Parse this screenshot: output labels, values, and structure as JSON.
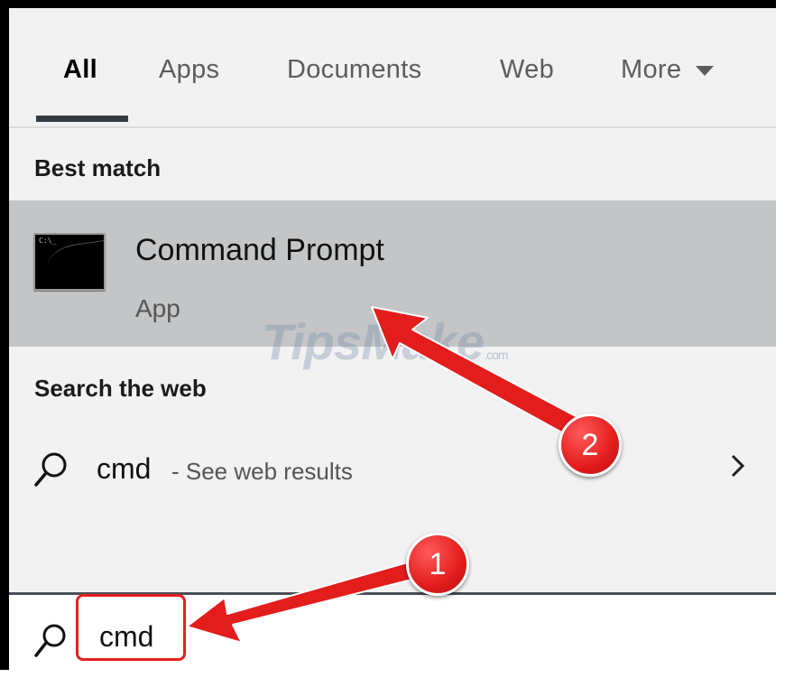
{
  "tabs": [
    {
      "label": "All",
      "active": true
    },
    {
      "label": "Apps"
    },
    {
      "label": "Documents"
    },
    {
      "label": "Web"
    },
    {
      "label": "More"
    }
  ],
  "best_match": {
    "heading": "Best match",
    "name": "Command Prompt",
    "type": "App",
    "icon": "cmd-icon"
  },
  "search_web": {
    "heading": "Search the web",
    "term": "cmd",
    "suffix": "- See web results"
  },
  "search_bar": {
    "query": "cmd"
  },
  "annotations": {
    "badge_1": "1",
    "badge_2": "2",
    "color": "#e31c1c"
  },
  "watermark": {
    "text": "TipsMake",
    "domain": ".com"
  }
}
